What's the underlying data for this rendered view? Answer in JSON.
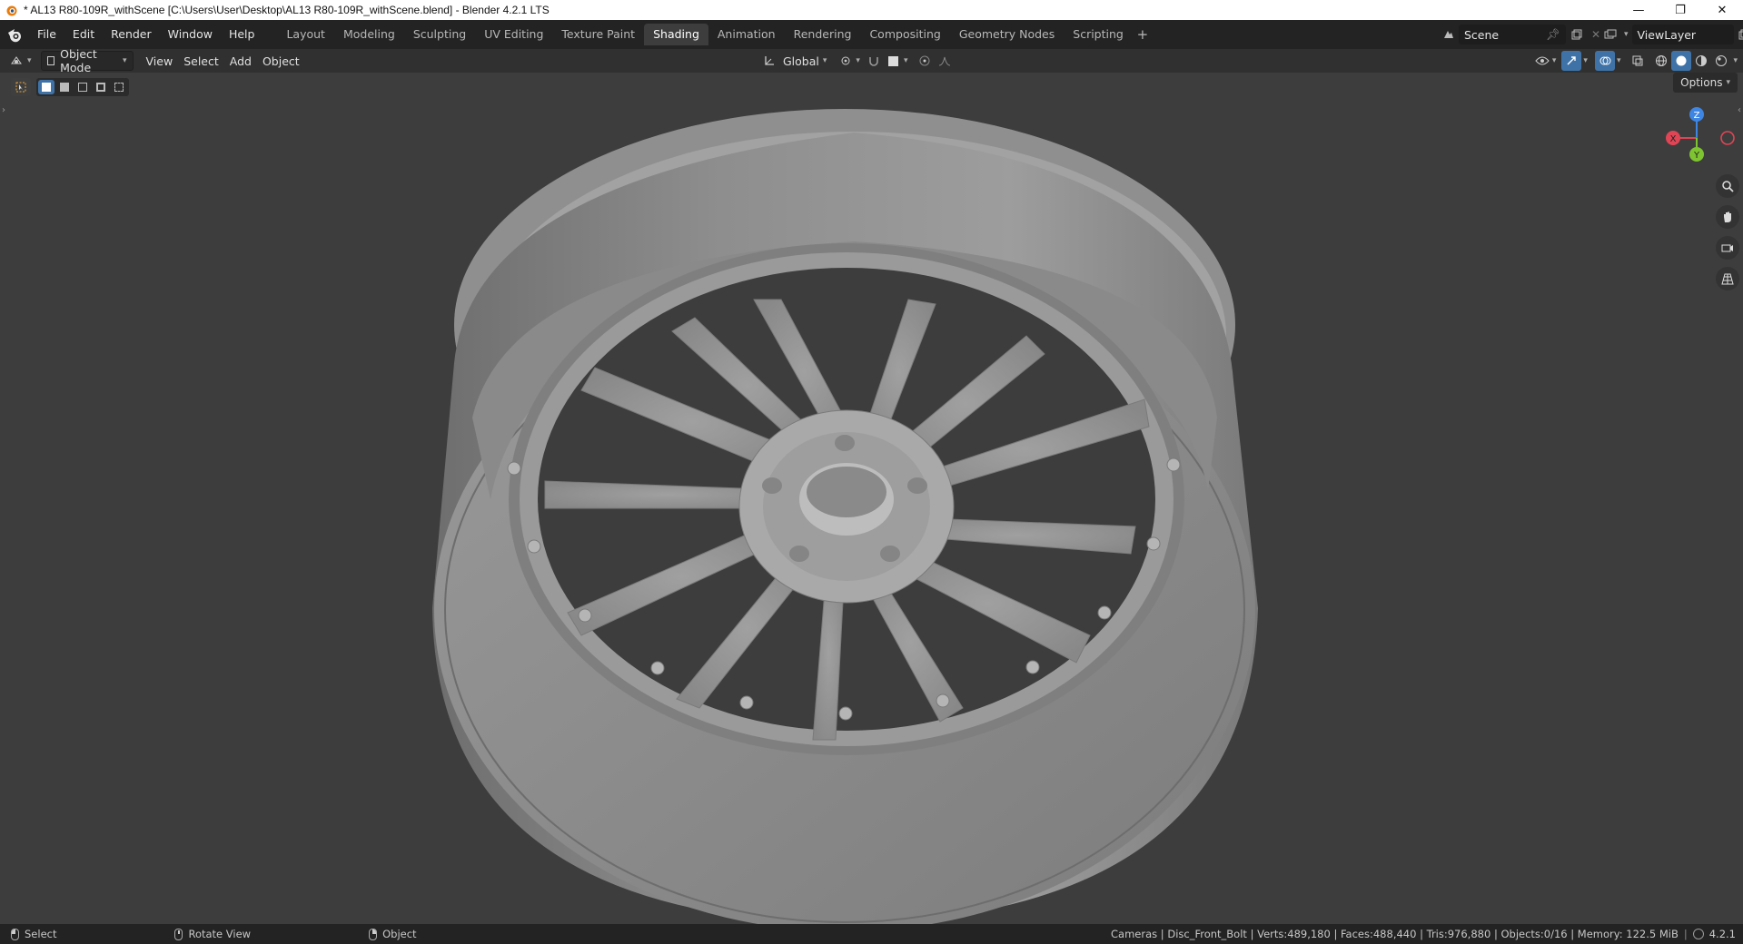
{
  "window": {
    "title": "* AL13 R80-109R_withScene [C:\\Users\\User\\Desktop\\AL13 R80-109R_withScene.blend] - Blender 4.2.1 LTS",
    "minimize": "—",
    "maximize": "❐",
    "close": "✕"
  },
  "menu": [
    "File",
    "Edit",
    "Render",
    "Window",
    "Help"
  ],
  "workspaces": [
    {
      "label": "Layout",
      "active": false
    },
    {
      "label": "Modeling",
      "active": false
    },
    {
      "label": "Sculpting",
      "active": false
    },
    {
      "label": "UV Editing",
      "active": false
    },
    {
      "label": "Texture Paint",
      "active": false
    },
    {
      "label": "Shading",
      "active": true
    },
    {
      "label": "Animation",
      "active": false
    },
    {
      "label": "Rendering",
      "active": false
    },
    {
      "label": "Compositing",
      "active": false
    },
    {
      "label": "Geometry Nodes",
      "active": false
    },
    {
      "label": "Scripting",
      "active": false
    }
  ],
  "workspace_add": "+",
  "scene": {
    "name": "Scene"
  },
  "view_layer": {
    "name": "ViewLayer"
  },
  "header": {
    "mode": "Object Mode",
    "view": "View",
    "select": "Select",
    "add": "Add",
    "object": "Object",
    "orientation": "Global"
  },
  "viewport": {
    "options": "Options",
    "gizmo": {
      "x": "X",
      "y": "Y",
      "z": "Z"
    }
  },
  "statusbar": {
    "select": "Select",
    "rotate": "Rotate View",
    "object": "Object",
    "stats": "Cameras | Disc_Front_Bolt | Verts:489,180 | Faces:488,440 | Tris:976,880 | Objects:0/16 | Memory: 122.5 MiB",
    "version": "4.2.1"
  },
  "colors": {
    "accent": "#3f73a8",
    "axis_x": "#e04555",
    "axis_y": "#7ec431",
    "axis_z": "#3e86e4"
  }
}
